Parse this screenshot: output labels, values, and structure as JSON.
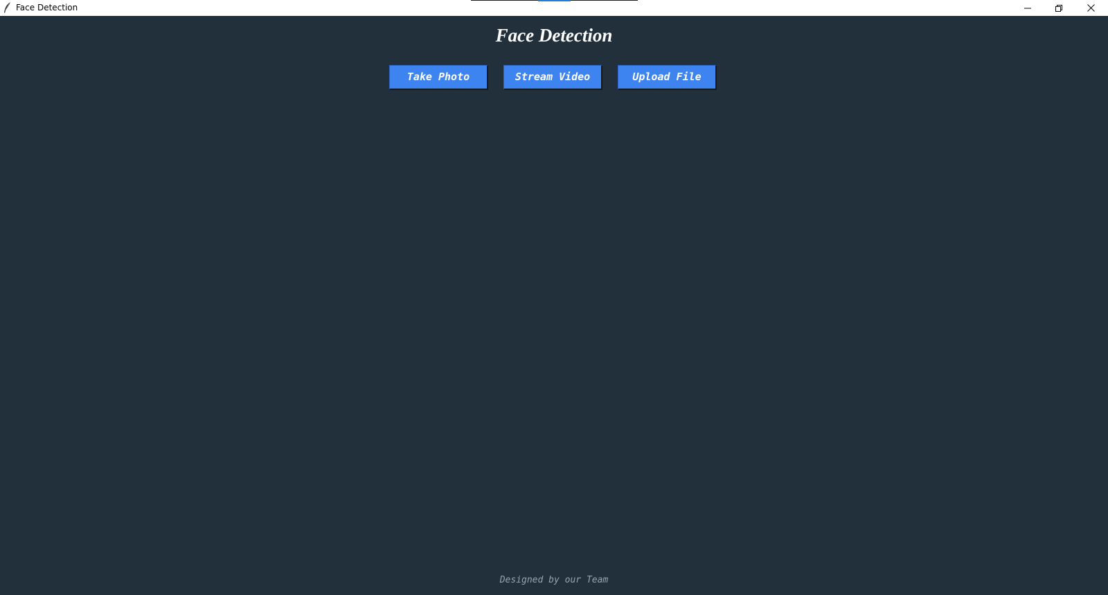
{
  "window": {
    "title": "Face Detection",
    "icons": {
      "app": "feather-icon",
      "minimize": "minimize-icon",
      "maximize": "restore-icon",
      "close": "close-icon"
    }
  },
  "main": {
    "heading": "Face Detection",
    "buttons": [
      {
        "label": "Take Photo"
      },
      {
        "label": "Stream Video"
      },
      {
        "label": "Upload File"
      }
    ],
    "footer": "Designed by our Team"
  },
  "colors": {
    "background": "#22303c",
    "button": "#3d84f0",
    "button_text": "#ffffff",
    "heading": "#ffffff",
    "footer_text": "#9aa5b0"
  }
}
